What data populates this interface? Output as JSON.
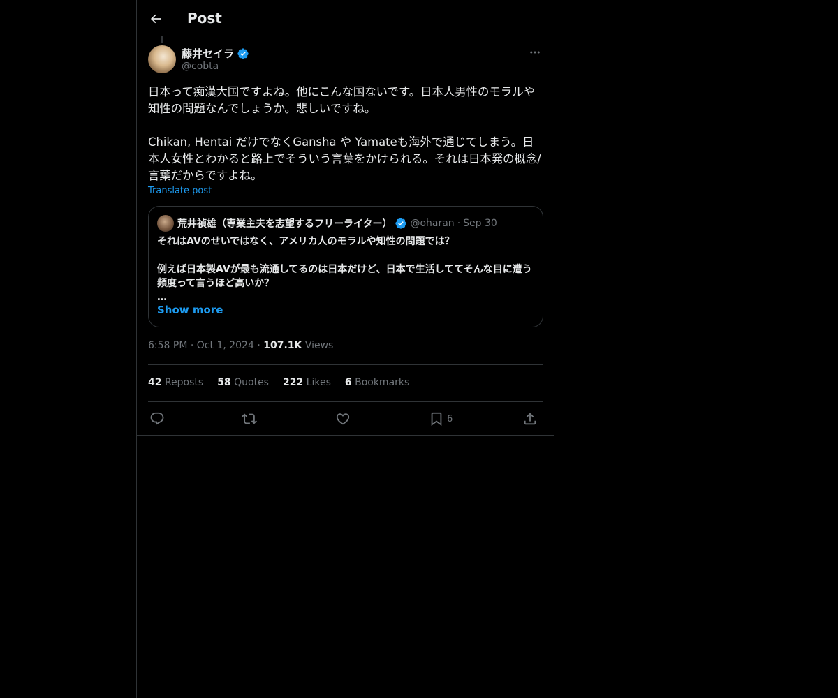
{
  "header": {
    "title": "Post"
  },
  "post": {
    "author": {
      "display_name": "藤井セイラ",
      "handle": "@cobta"
    },
    "text": "日本って痴漢大国ですよね。他にこんな国ないです。日本人男性のモラルや知性の問題なんでしょうか。悲しいですね。\n\nChikan, Hentai だけでなくGansha や Yamateも海外で通じてしまう。日本人女性とわかると路上でそういう言葉をかけられる。それは日本発の概念/言葉だからですよね。",
    "translate_label": "Translate post",
    "time": "6:58 PM",
    "date": "Oct 1, 2024",
    "views_count": "107.1K",
    "views_label": "Views",
    "sep": "·"
  },
  "quote": {
    "display_name": "荒井禎雄（専業主夫を志望するフリーライター）",
    "handle": "@oharan",
    "date": "Sep 30",
    "sep": "·",
    "text": "それはAVのせいではなく、アメリカ人のモラルや知性の問題では？\n\n例えば日本製AVが最も流通してるのは日本だけど、日本で生活しててそんな目に遭う頻度って言うほど高いか？\n…",
    "show_more": "Show more"
  },
  "stats": {
    "reposts_count": "42",
    "reposts_label": "Reposts",
    "quotes_count": "58",
    "quotes_label": "Quotes",
    "likes_count": "222",
    "likes_label": "Likes",
    "bookmarks_count": "6",
    "bookmarks_label": "Bookmarks"
  },
  "actions": {
    "bookmark_count": "6"
  },
  "icons": [
    "back-arrow-icon",
    "verified-badge-icon",
    "more-icon",
    "reply-icon",
    "repost-icon",
    "like-icon",
    "bookmark-icon",
    "share-icon"
  ],
  "colors": {
    "background": "#000000",
    "text": "#e7e9ea",
    "muted": "#71767b",
    "accent": "#1d9bf0",
    "border": "#2f3336"
  }
}
